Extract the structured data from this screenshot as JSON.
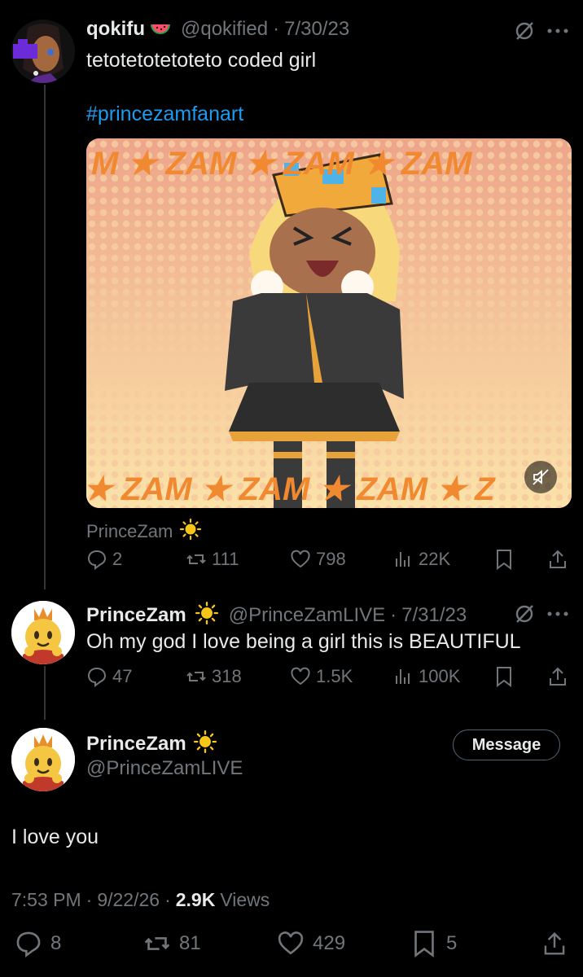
{
  "tweet1": {
    "display_name": "qokifu",
    "name_emoji": "watermelon-emoji",
    "handle": "@qokified",
    "separator": "·",
    "date": "7/30/23",
    "text": "tetotetotetoteto coded girl",
    "hashtag": "#princezamfanart",
    "media_caption_top": "M ★ ZAM ★ ZAM ★ ZAM",
    "media_caption_bottom": "★ ZAM ★ ZAM ★ ZAM ★ Z",
    "media_attribution": "PrinceZam",
    "media_icon": "mute-icon",
    "stats": {
      "replies": "2",
      "reposts": "111",
      "likes": "798",
      "views": "22K"
    }
  },
  "tweet2": {
    "display_name": "PrinceZam",
    "handle": "@PrinceZamLIVE",
    "separator": "·",
    "date": "7/31/23",
    "text": "Oh my god I love being a girl this is BEAUTIFUL",
    "stats": {
      "replies": "47",
      "reposts": "318",
      "likes": "1.5K",
      "views": "100K"
    }
  },
  "main": {
    "display_name": "PrinceZam",
    "handle": "@PrinceZamLIVE",
    "message_button": "Message",
    "text": "I love you",
    "time": "7:53 PM",
    "dot1": "·",
    "date": "9/22/26",
    "dot2": "·",
    "views_count": "2.9K",
    "views_label": "Views",
    "stats": {
      "replies": "8",
      "reposts": "81",
      "likes": "429",
      "bookmarks": "5"
    }
  },
  "colors": {
    "background": "#000000",
    "text": "#e7e9ea",
    "muted": "#71767b",
    "link": "#1d9bf0",
    "sun": "#f5c518"
  }
}
